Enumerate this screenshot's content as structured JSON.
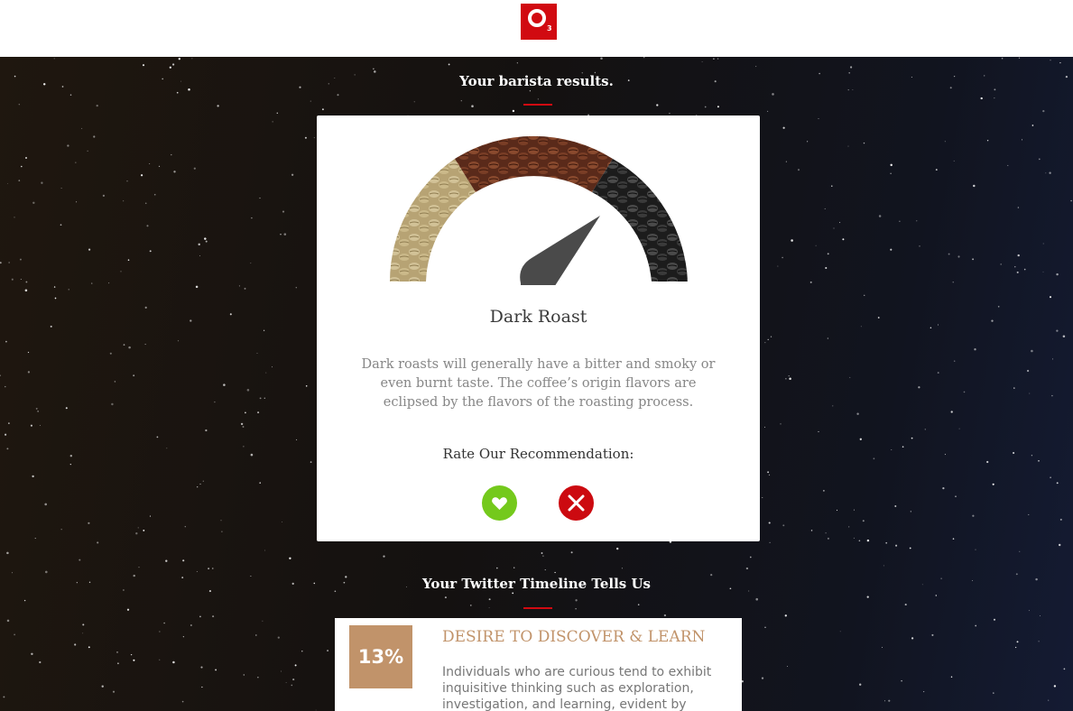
{
  "header": {
    "logo_letter": "O",
    "logo_subscript": "3",
    "brand_color": "#d10a11"
  },
  "results": {
    "heading": "Your barista results.",
    "roast_name": "Dark Roast",
    "description": "Dark roasts will generally have a bitter and smoky or even burnt taste. The coffee’s origin flavors are eclipsed by the flavors of the roasting process.",
    "gauge": {
      "scale": [
        "light",
        "medium",
        "dark"
      ],
      "selected": "dark"
    },
    "rate_label": "Rate Our Recommendation:",
    "like_icon": "heart-icon",
    "dislike_icon": "close-icon",
    "like_color": "#74c91c",
    "dislike_color": "#cc0a10"
  },
  "twitter": {
    "heading": "Your Twitter Timeline Tells Us",
    "trait": {
      "percent": "13%",
      "title": "DESIRE TO DISCOVER & LEARN",
      "description": "Individuals who are curious tend to exhibit inquisitive thinking such as exploration, investigation, and learning, evident by",
      "accent_color": "#c1936a"
    }
  }
}
